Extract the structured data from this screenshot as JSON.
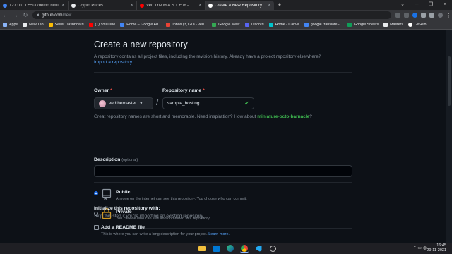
{
  "browser": {
    "tabs": [
      {
        "title": "127.0.0.1:5500/demo.html",
        "color": "#4285f4"
      },
      {
        "title": "Crypto Prices",
        "color": "#e8eaed"
      },
      {
        "title": "Ved The M A S T E R - YouTube",
        "color": "#ff0000"
      },
      {
        "title": "Create a New Repository",
        "color": "#ffffff"
      }
    ],
    "new_tab_glyph": "+",
    "address": {
      "host": "github.com",
      "path": "/new"
    },
    "bookmarks": [
      {
        "label": "Apps",
        "color": "#8ab4f8"
      },
      {
        "label": "New Tab",
        "color": "#e8eaed"
      },
      {
        "label": "Seller Dashboard",
        "color": "#fbbc04"
      },
      {
        "label": "(1) YouTube",
        "color": "#ff0000"
      },
      {
        "label": "Home – Google Ad...",
        "color": "#4285f4"
      },
      {
        "label": "Inbox (3,120) - ved...",
        "color": "#ea4335"
      },
      {
        "label": "Google Meet",
        "color": "#34a853"
      },
      {
        "label": "Discord",
        "color": "#5865f2"
      },
      {
        "label": "Home - Canva",
        "color": "#00c4cc"
      },
      {
        "label": "google translate -...",
        "color": "#4285f4"
      },
      {
        "label": "Google Sheets",
        "color": "#0f9d58"
      },
      {
        "label": "Masters",
        "color": "#e8eaed"
      },
      {
        "label": "GitHub",
        "color": "#ffffff"
      }
    ]
  },
  "form": {
    "title": "Create a new repository",
    "subtitle": "A repository contains all project files, including the revision history. Already have a project repository elsewhere?",
    "import_link": "Import a repository.",
    "owner_label": "Owner",
    "owner_value": "vedthemaster",
    "repo_label": "Repository name",
    "repo_value": "sample_hosting",
    "required_mark": "*",
    "separator": "/",
    "hint_text": "Great repository names are short and memorable. Need inspiration? How about ",
    "hint_suggestion": "miniature-octo-barnacle",
    "hint_end": "?",
    "description_label": "Description",
    "description_optional": "(optional)",
    "public_title": "Public",
    "public_desc": "Anyone on the internet can see this repository. You choose who can commit.",
    "private_title": "Private",
    "private_desc": "You choose who can see and commit to this repository.",
    "init_title": "Initialize this repository with:",
    "init_desc": "Skip this step if you're importing an existing repository.",
    "readme_title": "Add a README file",
    "readme_desc": "This is where you can write a long description for your project.",
    "readme_link": "Learn more.",
    "visibility_selected": "public"
  },
  "taskbar": {
    "time": "16:45",
    "date": "29-11-2021"
  }
}
